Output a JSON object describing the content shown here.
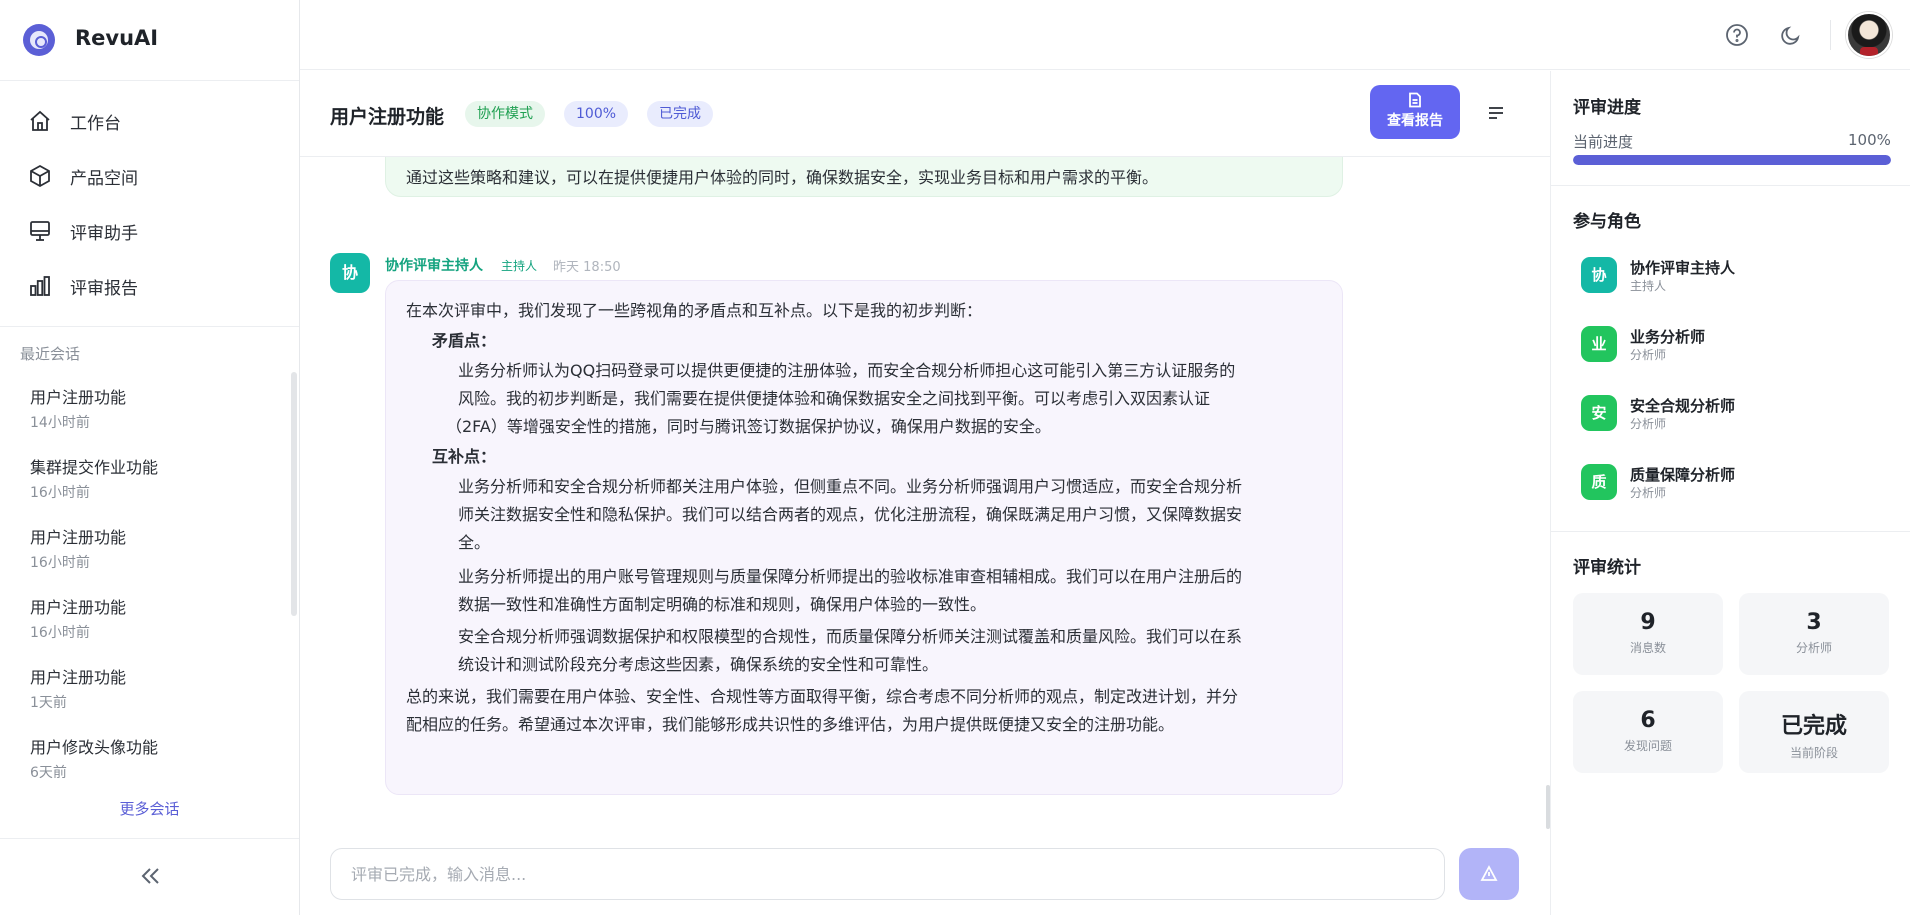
{
  "app": {
    "name": "RevuAI"
  },
  "nav": [
    {
      "label": "工作台",
      "icon": "home-icon"
    },
    {
      "label": "产品空间",
      "icon": "cube-icon"
    },
    {
      "label": "评审助手",
      "icon": "monitor-icon"
    },
    {
      "label": "评审报告",
      "icon": "bar-chart-icon"
    }
  ],
  "recent": {
    "title": "最近会话",
    "items": [
      {
        "title": "用户注册功能",
        "time": "14小时前"
      },
      {
        "title": "集群提交作业功能",
        "time": "16小时前"
      },
      {
        "title": "用户注册功能",
        "time": "16小时前"
      },
      {
        "title": "用户注册功能",
        "time": "16小时前"
      },
      {
        "title": "用户注册功能",
        "time": "1天前"
      },
      {
        "title": "用户修改头像功能",
        "time": "6天前"
      }
    ],
    "more": "更多会话"
  },
  "chat": {
    "title": "用户注册功能",
    "badges": {
      "mode": "协作模式",
      "percent": "100%",
      "status": "已完成"
    },
    "report_button": "查看报告",
    "previous_message_tail": "通过这些策略和建议，可以在提供便捷用户体验的同时，确保数据安全，实现业务目标和用户需求的平衡。",
    "message": {
      "avatar": "协",
      "sender": "协作评审主持人",
      "role": "主持人",
      "time": "昨天 18:50",
      "intro": "在本次评审中，我们发现了一些跨视角的矛盾点和互补点。以下是我的初步判断：",
      "conflict_heading": "矛盾点：",
      "conflict_lines": [
        "业务分析师认为QQ扫码登录可以提供更便捷的注册体验，而安全合规分析师担心这可能引入第三方认证服务的",
        "风险。我的初步判断是，我们需要在提供便捷体验和确保数据安全之间找到平衡。可以考虑引入双因素认证",
        "（2FA）等增强安全性的措施，同时与腾讯签订数据保护协议，确保用户数据的安全。"
      ],
      "complement_heading": "互补点：",
      "complement_para1": [
        "业务分析师和安全合规分析师都关注用户体验，但侧重点不同。业务分析师强调用户习惯适应，而安全合规分析",
        "师关注数据安全性和隐私保护。我们可以结合两者的观点，优化注册流程，确保既满足用户习惯，又保障数据安",
        "全。"
      ],
      "complement_para2": [
        "业务分析师提出的用户账号管理规则与质量保障分析师提出的验收标准审查相辅相成。我们可以在用户注册后的",
        "数据一致性和准确性方面制定明确的标准和规则，确保用户体验的一致性。"
      ],
      "complement_para3": [
        "安全合规分析师强调数据保护和权限模型的合规性，而质量保障分析师关注测试覆盖和质量风险。我们可以在系",
        "统设计和测试阶段充分考虑这些因素，确保系统的安全性和可靠性。"
      ],
      "summary": [
        "总的来说，我们需要在用户体验、安全性、合规性等方面取得平衡，综合考虑不同分析师的观点，制定改进计划，并分",
        "配相应的任务。希望通过本次评审，我们能够形成共识性的多维评估，为用户提供既便捷又安全的注册功能。"
      ]
    },
    "input_placeholder": "评审已完成，输入消息..."
  },
  "progress": {
    "title": "评审进度",
    "label": "当前进度",
    "value": "100%",
    "fraction": 1.0
  },
  "roles": {
    "title": "参与角色",
    "items": [
      {
        "icon": "协",
        "name": "协作评审主持人",
        "sub": "主持人",
        "color": "#14b8a6"
      },
      {
        "icon": "业",
        "name": "业务分析师",
        "sub": "分析师",
        "color": "#22c55e"
      },
      {
        "icon": "安",
        "name": "安全合规分析师",
        "sub": "分析师",
        "color": "#22c55e"
      },
      {
        "icon": "质",
        "name": "质量保障分析师",
        "sub": "分析师",
        "color": "#22c55e"
      }
    ]
  },
  "stats": {
    "title": "评审统计",
    "items": [
      {
        "value": "9",
        "label": "消息数"
      },
      {
        "value": "3",
        "label": "分析师"
      },
      {
        "value": "6",
        "label": "发现问题"
      },
      {
        "value": "已完成",
        "label": "当前阶段"
      }
    ]
  },
  "colors": {
    "accent": "#6366f1",
    "teal": "#14b8a6",
    "green": "#22c55e"
  }
}
